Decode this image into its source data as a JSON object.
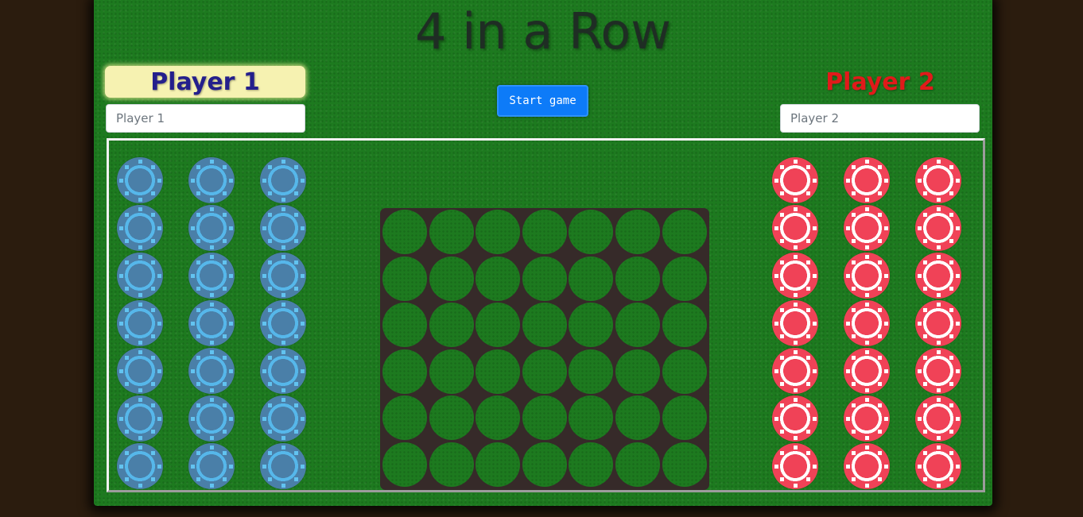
{
  "title": "4 in a Row",
  "player1": {
    "label": "Player 1",
    "input_placeholder": "Player 1",
    "input_value": ""
  },
  "player2": {
    "label": "Player 2",
    "input_placeholder": "Player 2",
    "input_value": ""
  },
  "controls": {
    "start_label": "Start game"
  },
  "colors": {
    "table": "#1d7a1f",
    "background": "#2b1c0e",
    "board": "#362a29",
    "player1_chip": "#4a7fa8",
    "player2_chip": "#f04257",
    "player1_label_bg": "#f6f2b1",
    "player1_label_text": "#241f8c",
    "player2_label_text": "#e11a1a",
    "start_button": "#0d7bf8"
  },
  "board": {
    "columns": 7,
    "rows": 6,
    "cells": [
      [
        "",
        "",
        "",
        "",
        "",
        "",
        ""
      ],
      [
        "",
        "",
        "",
        "",
        "",
        "",
        ""
      ],
      [
        "",
        "",
        "",
        "",
        "",
        "",
        ""
      ],
      [
        "",
        "",
        "",
        "",
        "",
        "",
        ""
      ],
      [
        "",
        "",
        "",
        "",
        "",
        "",
        ""
      ],
      [
        "",
        "",
        "",
        "",
        "",
        "",
        ""
      ]
    ]
  },
  "chip_stacks": {
    "player1": {
      "columns": 3,
      "chips_per_column": 7
    },
    "player2": {
      "columns": 3,
      "chips_per_column": 7
    }
  }
}
